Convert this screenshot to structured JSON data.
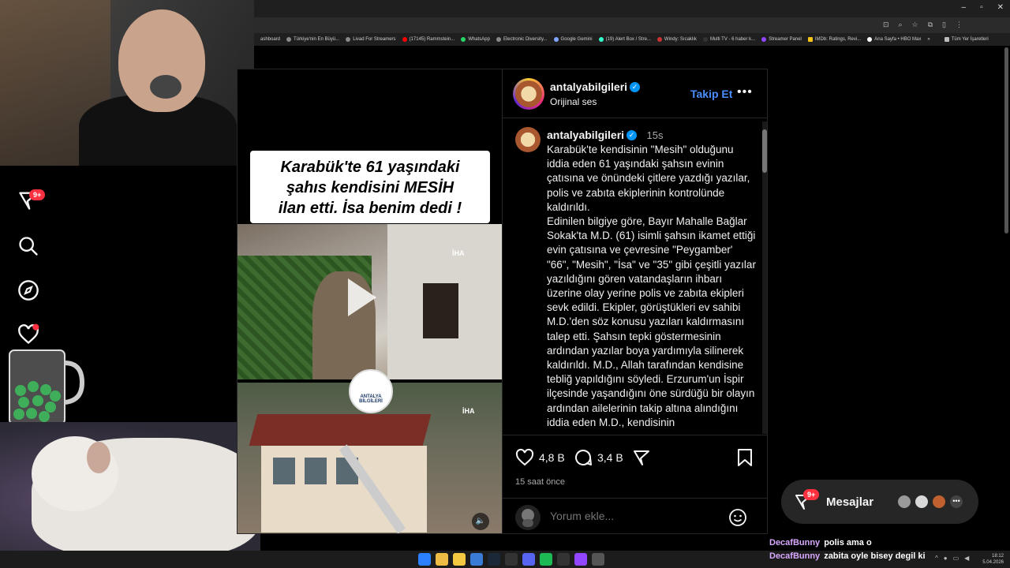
{
  "browser": {
    "window_controls": [
      "–",
      "▫",
      "✕"
    ],
    "address_icons": [
      "⊡",
      "⌕",
      "☆",
      "⧉",
      "▯",
      "⋮"
    ],
    "bookmarks": [
      "ashboard",
      "Türkiye'nin En Büyü...",
      "Livad For Streamers",
      "(17145) Rammstein...",
      "WhatsApp",
      "Electronic Diversity...",
      "Google Gemini",
      "(19) Alert Box / Stre...",
      "Windy: Sıcaklık",
      "Multi TV - 6 haber k...",
      "Streamer Panel",
      "IMDb: Ratings, Revi...",
      "Ana Sayfa • HBO Max",
      "»",
      "Tüm Yer İşaretleri"
    ]
  },
  "sidebar": {
    "notifications_badge": "9+",
    "icons": [
      "messenger-icon",
      "search-icon",
      "compass-icon",
      "heart-icon"
    ]
  },
  "video": {
    "headline": "Karabük'te 61 yaşındaki\nşahıs  kendisini  MESİH\nilan etti. İsa benim dedi !",
    "watermark": "İHA",
    "logo_text": "ANTALYA BİLGİLERİ"
  },
  "post": {
    "username": "antalyabilgileri",
    "audio": "Orijinal ses",
    "follow_label": "Takip Et",
    "caption_username": "antalyabilgileri",
    "caption_time": "15s",
    "caption": "Karabük'te kendisinin \"Mesih\" olduğunu iddia eden 61 yaşındaki şahsın evinin çatısına ve önündeki çitlere yazdığı yazılar, polis ve zabıta ekiplerinin kontrolünde kaldırıldı.\nEdinilen bilgiye göre, Bayır Mahalle Bağlar Sokak'ta M.D. (61) isimli şahsın ikamet ettiği evin çatısına ve çevresine \"Peygamber' \"66\", \"Mesih\", \"İsa\" ve \"35\" gibi çeşitli yazılar yazıldığını gören vatandaşların ihbarı üzerine olay yerine polis ve zabıta ekipleri sevk edildi. Ekipler, görüştükleri ev sahibi M.D.'den söz konusu yazıları kaldırmasını talep etti. Şahsın tepki göstermesinin ardından yazılar boya yardımıyla silinerek kaldırıldı. M.D., Allah tarafından kendisine tebliğ yapıldığını söyledi. Erzurum'un İspir ilçesinde yaşandığını öne sürdüğü bir olayın ardından ailelerinin takip altına alındığını iddia eden M.D., kendisinin",
    "likes": "4,8 B",
    "comments": "3,4 B",
    "time_ago": "15 saat önce",
    "comment_placeholder": "Yorum ekle..."
  },
  "messages": {
    "label": "Mesajlar",
    "badge": "9+"
  },
  "chat": [
    {
      "user": "DecafBunny",
      "msg": "polis ama o"
    },
    {
      "user": "DecafBunny",
      "msg": "zabita oyle bisey degil ki"
    }
  ],
  "taskbar": {
    "time": "18:12",
    "date": "5.04.2026"
  },
  "colors": {
    "accent_blue": "#4a8eff",
    "verified": "#0095f6",
    "badge_red": "#ff3040",
    "chat_user": "#d9a8ff"
  }
}
